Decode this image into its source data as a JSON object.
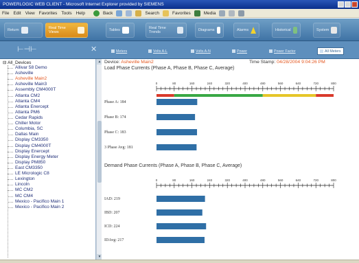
{
  "window": {
    "title": "POWERLOGIC WEB CLIENT - Microsoft Internet Explorer provided by SIEMENS"
  },
  "menu": {
    "items": [
      "File",
      "Edit",
      "View",
      "Favorites",
      "Tools",
      "Help"
    ],
    "toolbar": [
      "Back",
      "Search",
      "Favorites",
      "Media"
    ]
  },
  "nav": {
    "tabs": [
      {
        "label": "Return",
        "icon": "home-icon"
      },
      {
        "label": "Real Time Views",
        "icon": "table-icon"
      },
      {
        "label": "Tables",
        "icon": "grid-icon"
      },
      {
        "label": "Real Time Trends",
        "icon": "trend-icon"
      },
      {
        "label": "Diagrams",
        "icon": "diagram-icon"
      },
      {
        "label": "Alarms",
        "icon": "warning-icon"
      },
      {
        "label": "Historical",
        "icon": "history-icon"
      },
      {
        "label": "System",
        "icon": "wrench-icon"
      }
    ],
    "active_index": 1
  },
  "subtabs": {
    "items": [
      "Meters",
      "Volts A-L",
      "Volts A-N",
      "Power",
      "Power Factor",
      "All Meters"
    ],
    "active_index": 5
  },
  "sidebar": {
    "root": "All_Devices",
    "items": [
      "Allivar 58 Demo",
      "Asheville",
      "Asheville Main2",
      "Asheville Main3",
      "Assembly CM4000T",
      "Atlanta CM2",
      "Atlanta CM4",
      "Atlanta Enercept",
      "Atlanta PM6",
      "Cedar Rapids",
      "Chiller Motor",
      "Columbia, SC",
      "Dallas Main",
      "Display CM3350",
      "Display CM4000T",
      "Display Enercept",
      "Display Energy Meter",
      "Display PM850",
      "East CM3350",
      "LE Micrologic C8",
      "Lexington",
      "Lincoln",
      "MC CM2",
      "MC CM4",
      "Mexico - Pacifico Main 1",
      "Mexico - Pacifico Main 2"
    ],
    "selected_index": 2
  },
  "device": {
    "label": "Device:",
    "name": "Asheville Main2",
    "stamp_label": "Time Stamp:",
    "stamp": "04/28/2004 9:04:26 PM"
  },
  "chart_data": [
    {
      "type": "bar",
      "title": "Load Phase Currents (Phase A, Phase B, Phase C, Average)",
      "categories": [
        "Phase A",
        "Phase B",
        "Phase C",
        "3 Phase Avg"
      ],
      "values": [
        184,
        174,
        183,
        181
      ],
      "labels": [
        "Phase A: 184",
        "Phase B: 174",
        "Phase C: 183",
        "3 Phase Avg: 181"
      ],
      "xlim": [
        0,
        800
      ],
      "ticks": [
        0,
        80,
        160,
        240,
        320,
        400,
        480,
        560,
        640,
        720,
        800
      ],
      "range_band": [
        {
          "from": 0,
          "to": 80,
          "color": "#d93a2b"
        },
        {
          "from": 80,
          "to": 480,
          "color": "#39a845"
        },
        {
          "from": 480,
          "to": 720,
          "color": "#e6c629"
        },
        {
          "from": 720,
          "to": 800,
          "color": "#d93a2b"
        }
      ],
      "bar_color": "#2f6fa6"
    },
    {
      "type": "bar",
      "title": "Demand Phase Currents (Phase A, Phase B, Phase C, Average)",
      "categories": [
        "IAD",
        "IBD",
        "ICD",
        "IDAvg"
      ],
      "values": [
        219,
        207,
        224,
        217
      ],
      "labels": [
        "IAD: 219",
        "IBD: 207",
        "ICD: 224",
        "IDAvg: 217"
      ],
      "xlim": [
        0,
        800
      ],
      "ticks": [
        0,
        80,
        160,
        240,
        320,
        400,
        480,
        560,
        640,
        720,
        800
      ],
      "bar_color": "#2f6fa6"
    }
  ],
  "colors": {
    "accent": "#e3561e",
    "nav_bg": "#5e8fbd",
    "active_tab": "#f0b73e"
  }
}
